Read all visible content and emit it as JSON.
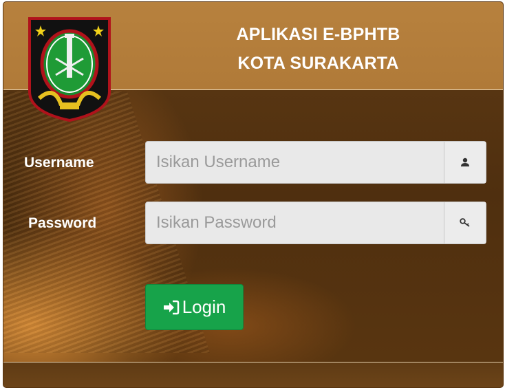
{
  "header": {
    "title_line1": "APLIKASI E-BPHTB",
    "title_line2": "KOTA SURAKARTA"
  },
  "form": {
    "username_label": "Username",
    "username_placeholder": "Isikan Username",
    "username_value": "",
    "password_label": "Password",
    "password_placeholder": "Isikan Password",
    "password_value": "",
    "login_label": "Login"
  },
  "icons": {
    "username_addon": "user-icon",
    "password_addon": "key-icon",
    "login": "sign-in-icon"
  },
  "colors": {
    "header": "#b7813e",
    "login_button": "#17a34a"
  }
}
